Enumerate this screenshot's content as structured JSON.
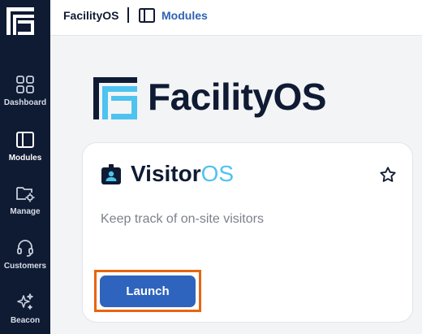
{
  "sidebar": {
    "logo_icon": "facilityos-logo-icon",
    "items": [
      {
        "label": "Dashboard",
        "icon": "grid-icon"
      },
      {
        "label": "Modules",
        "icon": "panel-icon"
      },
      {
        "label": "Manage",
        "icon": "folder-gear-icon"
      },
      {
        "label": "Customers",
        "icon": "headset-icon"
      },
      {
        "label": "Beacon",
        "icon": "sparkles-icon"
      }
    ]
  },
  "breadcrumb": {
    "root": "FacilityOS",
    "current": "Modules",
    "current_icon": "panel-icon"
  },
  "brand": {
    "name": "FacilityOS"
  },
  "module_card": {
    "title_main": "Visitor",
    "title_accent": "OS",
    "description": "Keep track of on-site visitors",
    "button_label": "Launch",
    "icon": "badge-icon",
    "favorite_icon": "star-icon"
  },
  "colors": {
    "sidebar": "#0f1b33",
    "accent": "#4ec3ef",
    "primary_button": "#2e64bd",
    "highlight": "#e8650f"
  }
}
